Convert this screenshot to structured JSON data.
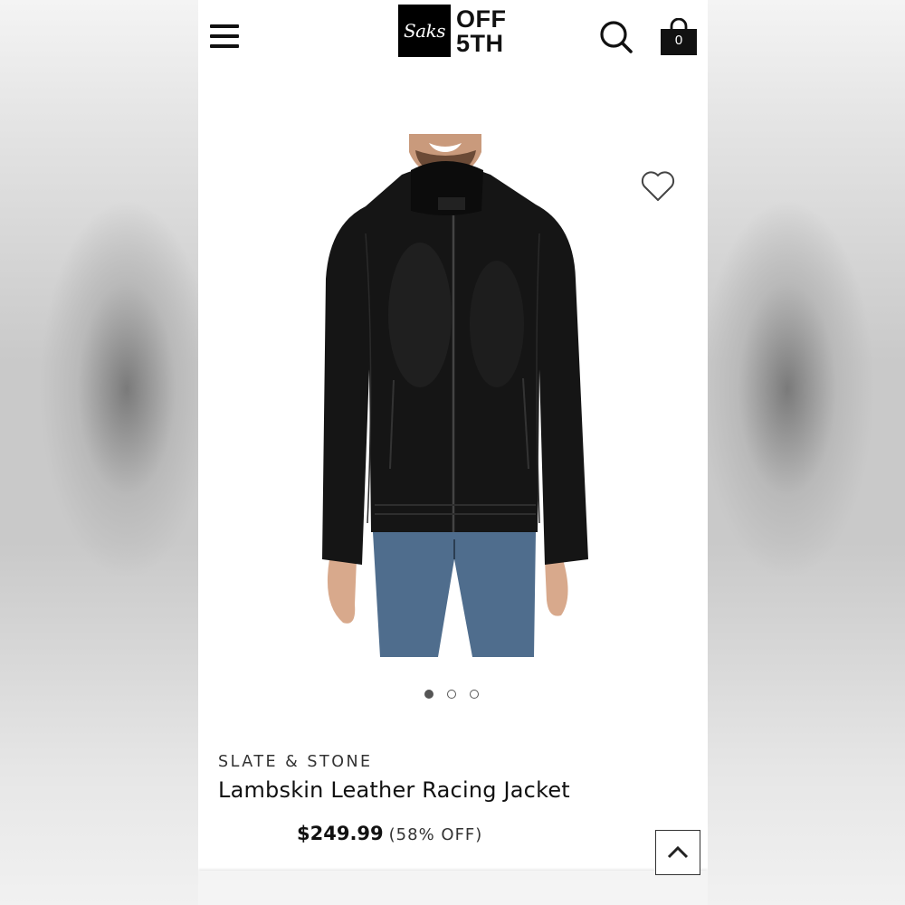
{
  "header": {
    "logo_script": "Saks",
    "logo_line1": "OFF",
    "logo_line2": "5TH",
    "bag_count": "0",
    "icons": [
      "menu-icon",
      "search-icon",
      "shopping-bag-icon"
    ]
  },
  "product": {
    "brand": "SLATE & STONE",
    "name": "Lambskin Leather Racing Jacket",
    "price": "$249.99",
    "discount": "(58% OFF)",
    "image_count": 3,
    "active_image": 1
  },
  "colors": {
    "ink": "#111111",
    "muted": "#555555",
    "background": "#ffffff"
  }
}
